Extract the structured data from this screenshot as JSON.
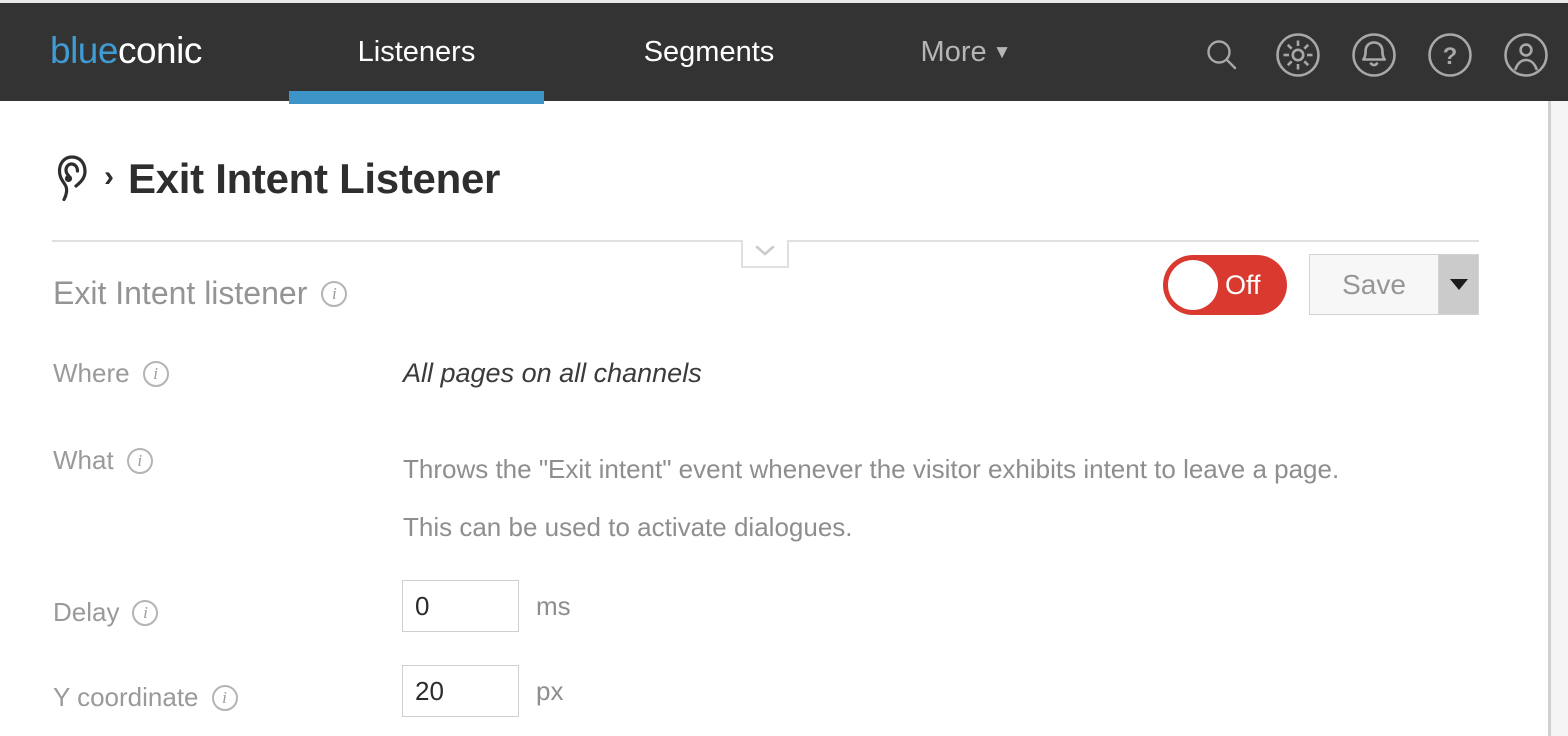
{
  "brand": {
    "logo_first": "blue",
    "logo_second": "conic",
    "accent_blue": "#3f9bd4",
    "tab_underline": "#3f94c7",
    "nav_background": "#333333",
    "toggle_off_color": "#d9392f"
  },
  "topnav": {
    "items": [
      {
        "label": "Listeners",
        "active": true
      },
      {
        "label": "Segments",
        "active": false
      },
      {
        "label": "More",
        "caret": "▼",
        "active": false
      }
    ],
    "icons": [
      {
        "name": "search-icon"
      },
      {
        "name": "settings-gear-icon"
      },
      {
        "name": "notifications-bell-icon"
      },
      {
        "name": "help-question-icon"
      },
      {
        "name": "user-account-icon"
      }
    ]
  },
  "header": {
    "breadcrumb_icon": "ear-listener-icon",
    "breadcrumb_separator": "›",
    "title": "Exit Intent Listener",
    "toggle": {
      "label": "Off",
      "state": "off"
    },
    "save": {
      "label": "Save",
      "caret": "▼"
    }
  },
  "collapse_tab": {
    "icon": "chevron-down-icon"
  },
  "content": {
    "section_title": "Exit Intent listener",
    "info_glyph": "i",
    "rows": [
      {
        "label": "Where",
        "value": "All pages on all channels"
      },
      {
        "label": "What",
        "lines": [
          "Throws the \"Exit intent\" event whenever the visitor exhibits intent to leave a page.",
          "This can be used to activate dialogues."
        ]
      },
      {
        "label": "Delay",
        "input_value": "0",
        "unit": "ms"
      },
      {
        "label": "Y coordinate",
        "input_value": "20",
        "unit": "px"
      }
    ]
  }
}
